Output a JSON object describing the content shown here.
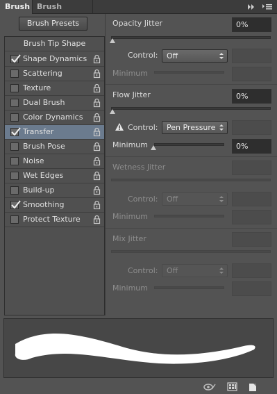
{
  "tabs": [
    {
      "label": "Brush",
      "active": true
    },
    {
      "label": "Brush Presets",
      "active": false
    }
  ],
  "left": {
    "presets_button": "Brush Presets",
    "tip_shape": "Brush Tip Shape",
    "items": [
      {
        "label": "Shape Dynamics",
        "checked": true,
        "selected": false
      },
      {
        "label": "Scattering",
        "checked": false,
        "selected": false
      },
      {
        "label": "Texture",
        "checked": false,
        "selected": false
      },
      {
        "label": "Dual Brush",
        "checked": false,
        "selected": false
      },
      {
        "label": "Color Dynamics",
        "checked": false,
        "selected": false
      },
      {
        "label": "Transfer",
        "checked": true,
        "selected": true
      },
      {
        "label": "Brush Pose",
        "checked": false,
        "selected": false
      },
      {
        "label": "Noise",
        "checked": false,
        "selected": false
      },
      {
        "label": "Wet Edges",
        "checked": false,
        "selected": false
      },
      {
        "label": "Build-up",
        "checked": false,
        "selected": false
      },
      {
        "label": "Smoothing",
        "checked": true,
        "selected": false
      },
      {
        "label": "Protect Texture",
        "checked": false,
        "selected": false
      }
    ]
  },
  "opacity": {
    "label": "Opacity Jitter",
    "value": "0%",
    "control_label": "Control:",
    "control_value": "Off",
    "minimum_label": "Minimum"
  },
  "flow": {
    "label": "Flow Jitter",
    "value": "0%",
    "control_label": "Control:",
    "control_value": "Pen Pressure",
    "minimum_label": "Minimum",
    "minimum_value": "0%"
  },
  "wetness": {
    "label": "Wetness Jitter",
    "control_label": "Control:",
    "control_value": "Off",
    "minimum_label": "Minimum"
  },
  "mix": {
    "label": "Mix Jitter",
    "control_label": "Control:",
    "control_value": "Off",
    "minimum_label": "Minimum"
  },
  "icons": {
    "panel_menu": "panel-menu-icon",
    "collapse": "double-arrow-icon",
    "warning": "warning-icon",
    "toggle_bristle": "bristle-preview-icon",
    "brush_panel": "brush-panel-icon",
    "new_preset": "new-preset-icon"
  }
}
